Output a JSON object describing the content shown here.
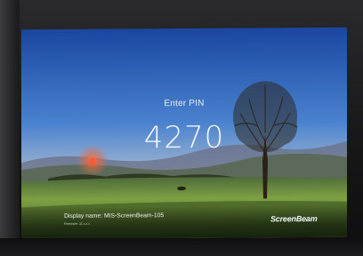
{
  "pin_screen": {
    "prompt": "Enter PIN",
    "pin": "4270"
  },
  "footer": {
    "display_name": "Display name: MIS-ScreenBeam-105",
    "version": "Firmware: 11.x.x.x",
    "brand": "ScreenBeam"
  },
  "wallpaper": {
    "description_icon": "landscape-wallpaper",
    "colors": {
      "sky_top": "#1f4fa8",
      "sky_mid": "#4f86d0",
      "horizon": "#e79a63",
      "sun": "#f25c3a",
      "field": "#6a8f3a",
      "tree": "#2a2218"
    }
  }
}
